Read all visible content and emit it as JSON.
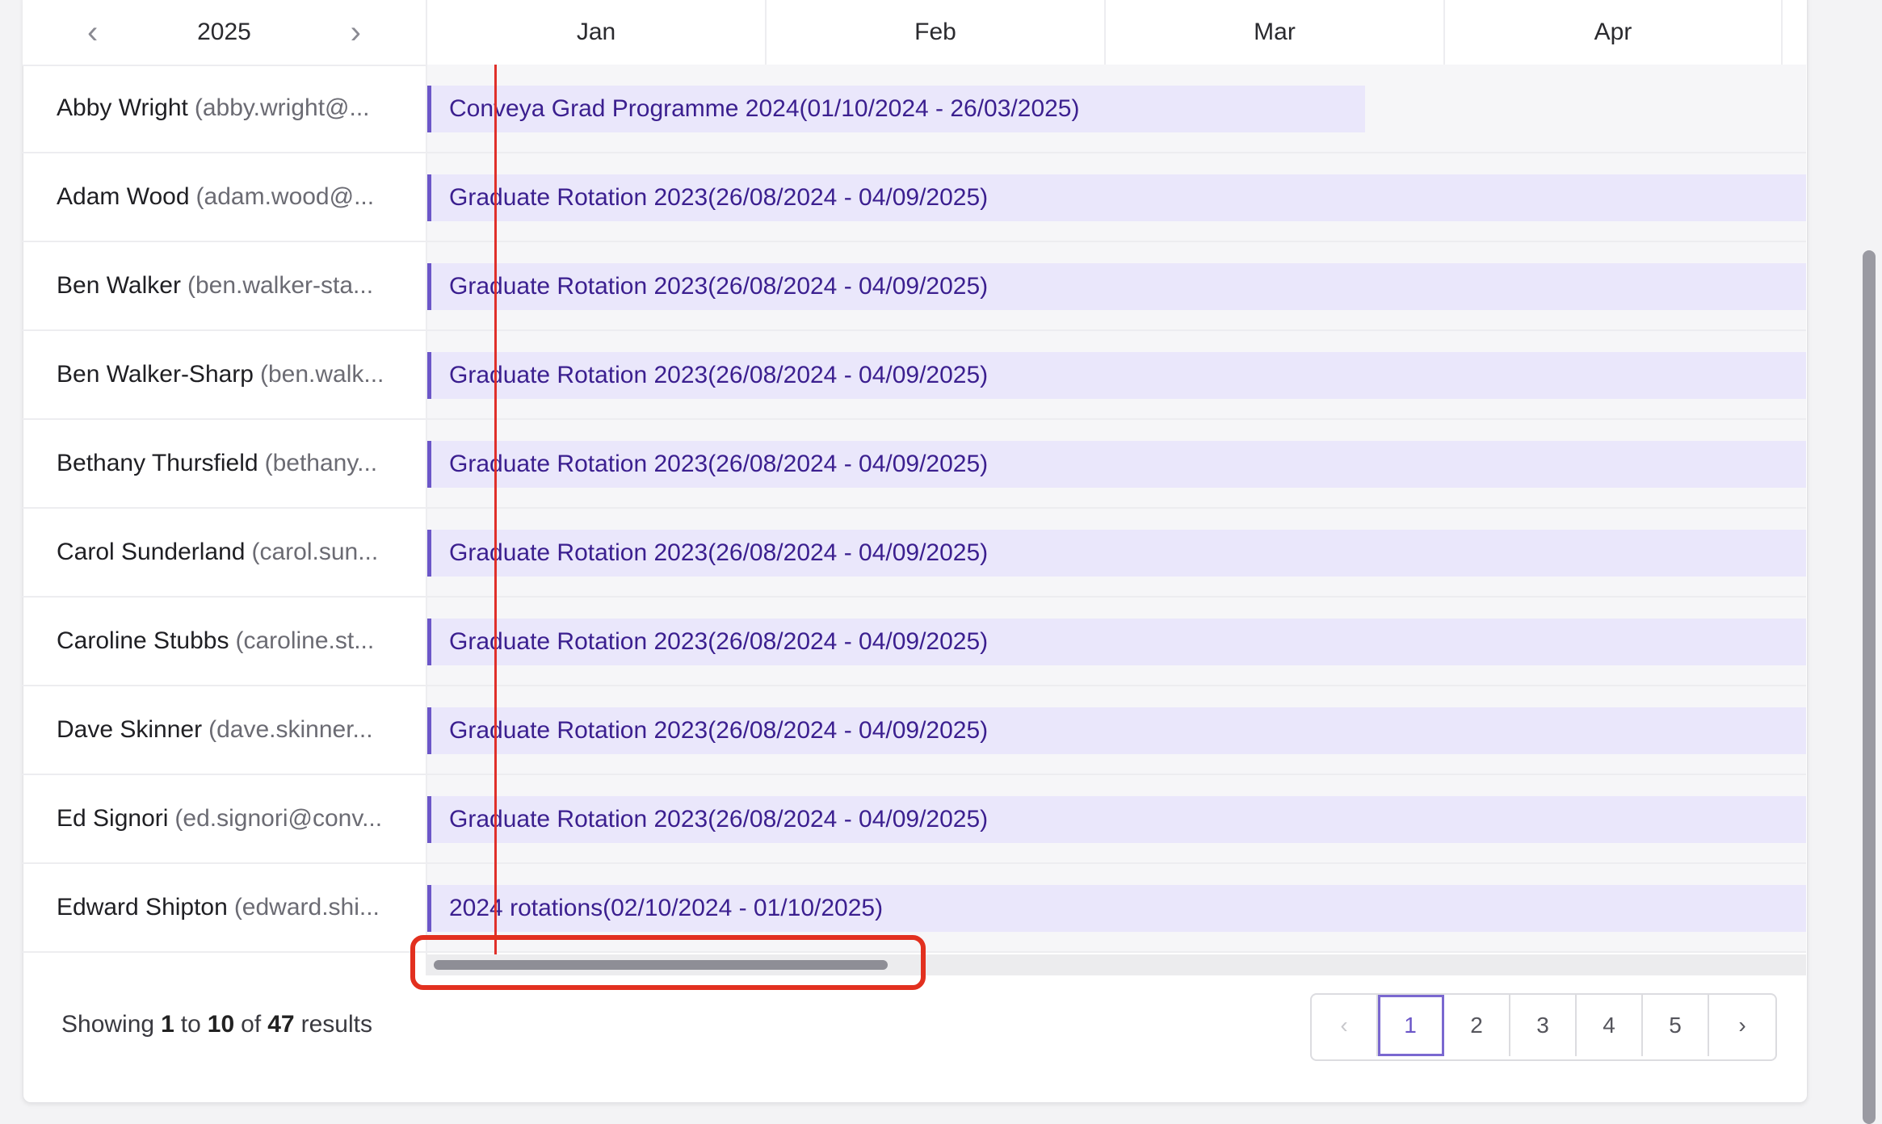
{
  "header": {
    "year": "2025",
    "prev_icon": "chevron-left-icon",
    "next_icon": "chevron-right-icon",
    "months": [
      "Jan",
      "Feb",
      "Mar",
      "Apr"
    ]
  },
  "rows": [
    {
      "name": "Abby Wright",
      "email": "(abby.wright@...",
      "assignment": "Conveya Grad Programme 2024(01/10/2024 - 26/03/2025)"
    },
    {
      "name": "Adam Wood",
      "email": "(adam.wood@...",
      "assignment": "Graduate Rotation 2023(26/08/2024 - 04/09/2025)"
    },
    {
      "name": "Ben Walker",
      "email": "(ben.walker-sta...",
      "assignment": "Graduate Rotation 2023(26/08/2024 - 04/09/2025)"
    },
    {
      "name": "Ben Walker-Sharp",
      "email": "(ben.walk...",
      "assignment": "Graduate Rotation 2023(26/08/2024 - 04/09/2025)"
    },
    {
      "name": "Bethany Thursfield",
      "email": "(bethany...",
      "assignment": "Graduate Rotation 2023(26/08/2024 - 04/09/2025)"
    },
    {
      "name": "Carol Sunderland",
      "email": "(carol.sun...",
      "assignment": "Graduate Rotation 2023(26/08/2024 - 04/09/2025)"
    },
    {
      "name": "Caroline Stubbs",
      "email": "(caroline.st...",
      "assignment": "Graduate Rotation 2023(26/08/2024 - 04/09/2025)"
    },
    {
      "name": "Dave Skinner",
      "email": "(dave.skinner...",
      "assignment": "Graduate Rotation 2023(26/08/2024 - 04/09/2025)"
    },
    {
      "name": "Ed Signori",
      "email": "(ed.signori@conv...",
      "assignment": "Graduate Rotation 2023(26/08/2024 - 04/09/2025)"
    },
    {
      "name": "Edward Shipton",
      "email": "(edward.shi...",
      "assignment": "2024 rotations(02/10/2024 - 01/10/2025)"
    }
  ],
  "footer": {
    "showing_prefix": "Showing",
    "from": "1",
    "to_word": "to",
    "to": "10",
    "of_word": "of",
    "total": "47",
    "suffix": "results"
  },
  "pagination": {
    "prev": "‹",
    "pages": [
      "1",
      "2",
      "3",
      "4",
      "5"
    ],
    "next": "›",
    "current": "1"
  },
  "colors": {
    "accent": "#6b56c8",
    "bar_bg": "#eae7fb",
    "bar_text": "#3b1f8f",
    "today_line": "#e0302a",
    "highlight": "#e2301f"
  }
}
